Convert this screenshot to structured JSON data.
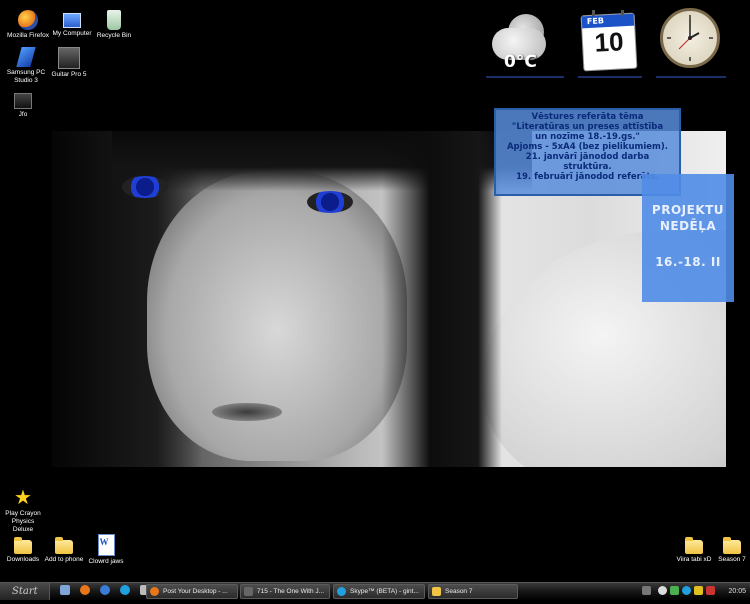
{
  "desktop_icons": {
    "firefox": "Mozilla Firefox",
    "my_computer": "My Computer",
    "recycle_bin": "Recycle Bin",
    "samsung_line1": "Samsung PC",
    "samsung_line2": "Studio 3",
    "guitar_pro": "Guitar Pro 5",
    "jfo": "Jfo",
    "crayon_line1": "Play Crayon",
    "crayon_line2": "Physics",
    "crayon_line3": "Deluxe",
    "downloads": "Downloads",
    "add_to_phone": "Add to phone",
    "clowrd_jaws": "Clowrd jaws",
    "viira_tabi": "Viira tabi xD",
    "season7": "Season 7"
  },
  "gadgets": {
    "weather_temp": "0°C",
    "calendar_month": "FEB",
    "calendar_day": "10"
  },
  "note1": {
    "line1": "Vēstures referāta tēma",
    "line2": "\"Literatūras un preses attīstība",
    "line3": "un nozīme 18.-19.gs.\"",
    "line4": "Apjoms - 5xA4 (bez pielikumiem).",
    "line5": "21. janvārī jānodod darba",
    "line6": "struktūra.",
    "line7": "19. februārī jānodod referāts."
  },
  "note2": {
    "line1": "PROJEKTU",
    "line2": "NEDĒĻA",
    "dates": "16.-18. II"
  },
  "taskbar": {
    "start": "Start",
    "task1": "Post Your Desktop - ...",
    "task2": "715 - The One With J...",
    "task3": "Skype™ (BETA) - gint...",
    "task4": "Season 7",
    "time": "20:05"
  }
}
